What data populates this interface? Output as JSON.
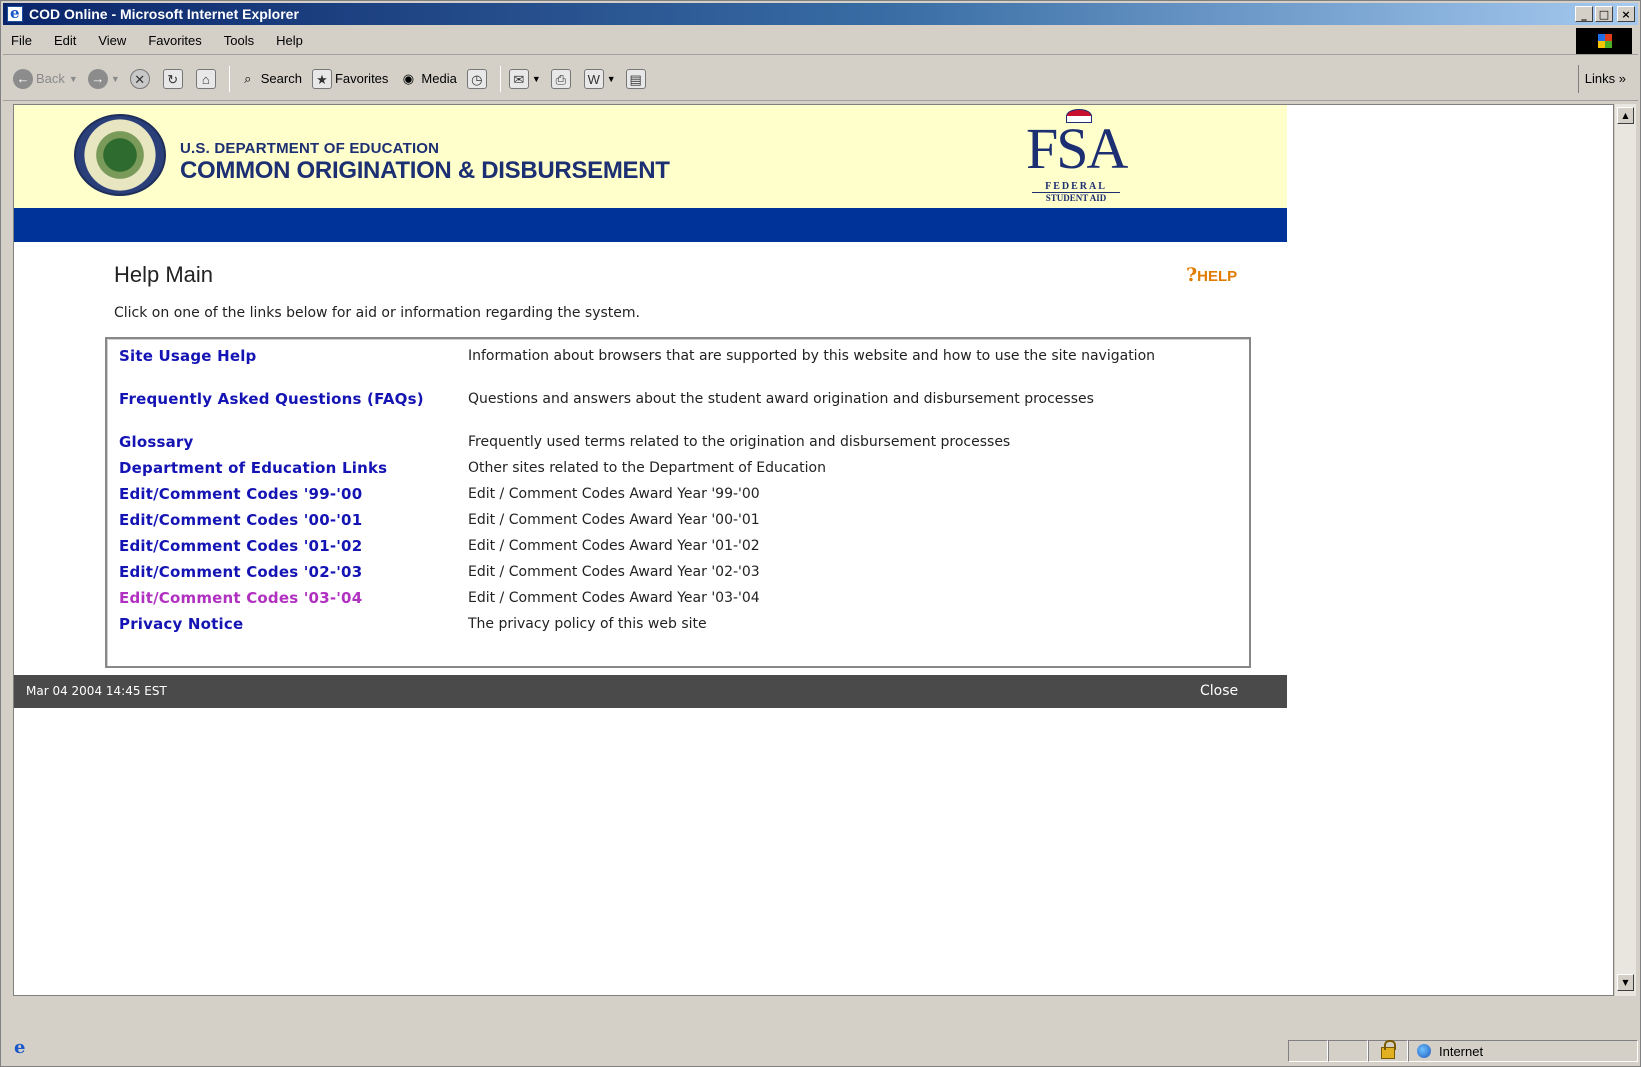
{
  "window": {
    "title": "COD Online - Microsoft Internet Explorer",
    "controls": {
      "minimize": "_",
      "maximize": "□",
      "close": "×"
    }
  },
  "menu": [
    "File",
    "Edit",
    "View",
    "Favorites",
    "Tools",
    "Help"
  ],
  "toolbar": {
    "back": "Back",
    "search": "Search",
    "favorites": "Favorites",
    "media": "Media",
    "links": "Links »"
  },
  "header": {
    "department": "U.S. DEPARTMENT OF EDUCATION",
    "system": "COMMON ORIGINATION & DISBURSEMENT",
    "fsa_logo": {
      "word": "FSA",
      "line1": "FEDERAL",
      "line2": "STUDENT AID"
    }
  },
  "page": {
    "title": "Help Main",
    "help_link": "HELP",
    "intro": "Click on one of the links below for aid or information regarding the system."
  },
  "help_items": [
    {
      "link": "Site Usage Help",
      "description": "Information about browsers that are supported by this website and how to use the site navigation"
    },
    {
      "link": "Frequently Asked Questions (FAQs)",
      "description": "Questions and answers about the student award origination and disbursement processes"
    },
    {
      "link": "Glossary",
      "description": "Frequently used terms related to the origination and disbursement processes"
    },
    {
      "link": "Department of Education Links",
      "description": "Other sites related to the Department of Education"
    },
    {
      "link": "Edit/Comment Codes '99-'00",
      "description": "Edit / Comment Codes Award Year '99-'00"
    },
    {
      "link": "Edit/Comment Codes '00-'01",
      "description": "Edit / Comment Codes Award Year '00-'01"
    },
    {
      "link": "Edit/Comment Codes '01-'02",
      "description": "Edit / Comment Codes Award Year '01-'02"
    },
    {
      "link": "Edit/Comment Codes '02-'03",
      "description": "Edit / Comment Codes Award Year '02-'03"
    },
    {
      "link": "Edit/Comment Codes '03-'04",
      "description": "Edit / Comment Codes Award Year '03-'04",
      "visited": true
    },
    {
      "link": "Privacy Notice",
      "description": "The privacy policy of this web site"
    }
  ],
  "footer": {
    "timestamp": "Mar 04 2004 14:45 EST",
    "close": "Close"
  },
  "statusbar": {
    "zone": "Internet"
  },
  "colors": {
    "banner_bg": "#ffffcc",
    "band_blue": "#003399",
    "link_blue": "#1414b4",
    "link_visited": "#b030c0",
    "help_orange": "#e07c00",
    "footer_bg": "#4a4a4a"
  }
}
